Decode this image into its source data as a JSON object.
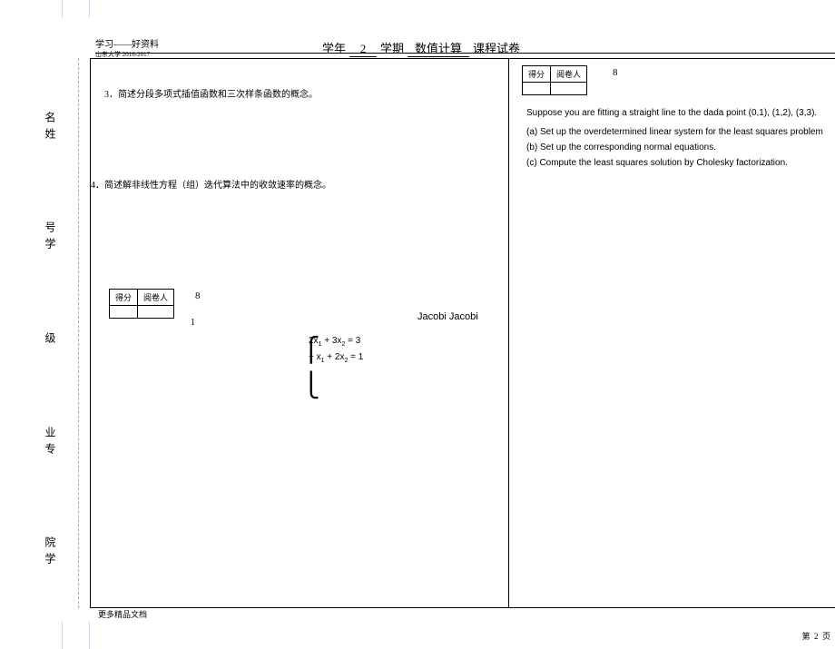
{
  "header": {
    "study": "学习——好资料",
    "sub": "山东大学 2016-2017",
    "year_label": "学年",
    "year_val": "2",
    "term_label": "学期",
    "course_val": "数值计算",
    "exam_label": "课程试卷"
  },
  "side": {
    "l1": "名姓",
    "l2": "号学",
    "l3": "级",
    "l4": "业专",
    "l5": "院学"
  },
  "q3": "3．简述分段多项式插值函数和三次样条函数的概念。",
  "q4": "4．简述解非线性方程（组）迭代算法中的收敛速率的概念。",
  "score_headers": {
    "score": "得分",
    "reviewer": "阅卷人"
  },
  "sb1_pts": "8",
  "sb1_num": "1",
  "jacobi": "Jacobi  Jacobi",
  "eq1_a": "2x",
  "eq1_b": "1",
  "eq1_c": " + 3x",
  "eq1_d": "2",
  "eq1_e": " =  3",
  "eq2_a": "− x",
  "eq2_b": "1",
  "eq2_c": " + 2x",
  "eq2_d": "2",
  "eq2_e": " =  1",
  "sb2_pts": "8",
  "suppose": "Suppose you are fitting a straight line to the dada point (0,1), (1,2), (3,3).",
  "parts": {
    "a": "(a) Set up the overdetermined linear system for the least squares problem",
    "b": "(b) Set up the corresponding normal equations.",
    "c": "(c) Compute the least squares solution by Cholesky factorization."
  },
  "footer_l": "更多精品文档",
  "footer_r_pre": "第",
  "footer_r_num": "2",
  "footer_r_suf": "页"
}
